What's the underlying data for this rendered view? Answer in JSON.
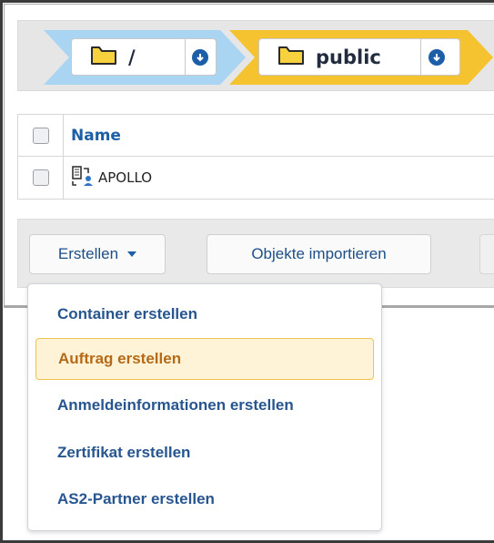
{
  "breadcrumb": {
    "items": [
      {
        "label": "/",
        "icon": "folder-icon",
        "color": "#a9d4f2"
      },
      {
        "label": "public",
        "icon": "folder-icon",
        "color": "#f5c330"
      }
    ]
  },
  "table": {
    "header": {
      "name": "Name"
    },
    "rows": [
      {
        "name": "APOLLO",
        "icon": "job-icon"
      }
    ]
  },
  "toolbar": {
    "create_label": "Erstellen",
    "import_label": "Objekte importieren"
  },
  "menu": {
    "items": [
      {
        "label": "Container erstellen"
      },
      {
        "label": "Auftrag erstellen",
        "highlighted": true
      },
      {
        "label": "Anmeldeinformationen erstellen"
      },
      {
        "label": "Zertifikat erstellen"
      },
      {
        "label": "AS2-Partner erstellen"
      }
    ]
  },
  "colors": {
    "accent": "#1c5fa8",
    "link": "#1d5fa5",
    "highlight_bg": "#fef3d6",
    "highlight_border": "#f0c44c",
    "highlight_text": "#b56a18"
  }
}
